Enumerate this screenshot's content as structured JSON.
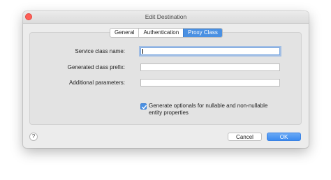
{
  "window": {
    "title": "Edit Destination"
  },
  "tabs": [
    {
      "label": "General",
      "active": false
    },
    {
      "label": "Authentication",
      "active": false
    },
    {
      "label": "Proxy Class",
      "active": true
    }
  ],
  "form": {
    "service_class_name": {
      "label": "Service class name:",
      "value": ""
    },
    "generated_class_prefix": {
      "label": "Generated class prefix:",
      "value": ""
    },
    "additional_parameters": {
      "label": "Additional parameters:",
      "value": ""
    },
    "generate_optionals": {
      "label": "Generate optionals for nullable and non-nullable entity properties",
      "checked": true
    }
  },
  "footer": {
    "help_label": "?",
    "cancel_label": "Cancel",
    "ok_label": "OK"
  },
  "colors": {
    "accent": "#4a90e2",
    "close": "#ff5f57"
  }
}
